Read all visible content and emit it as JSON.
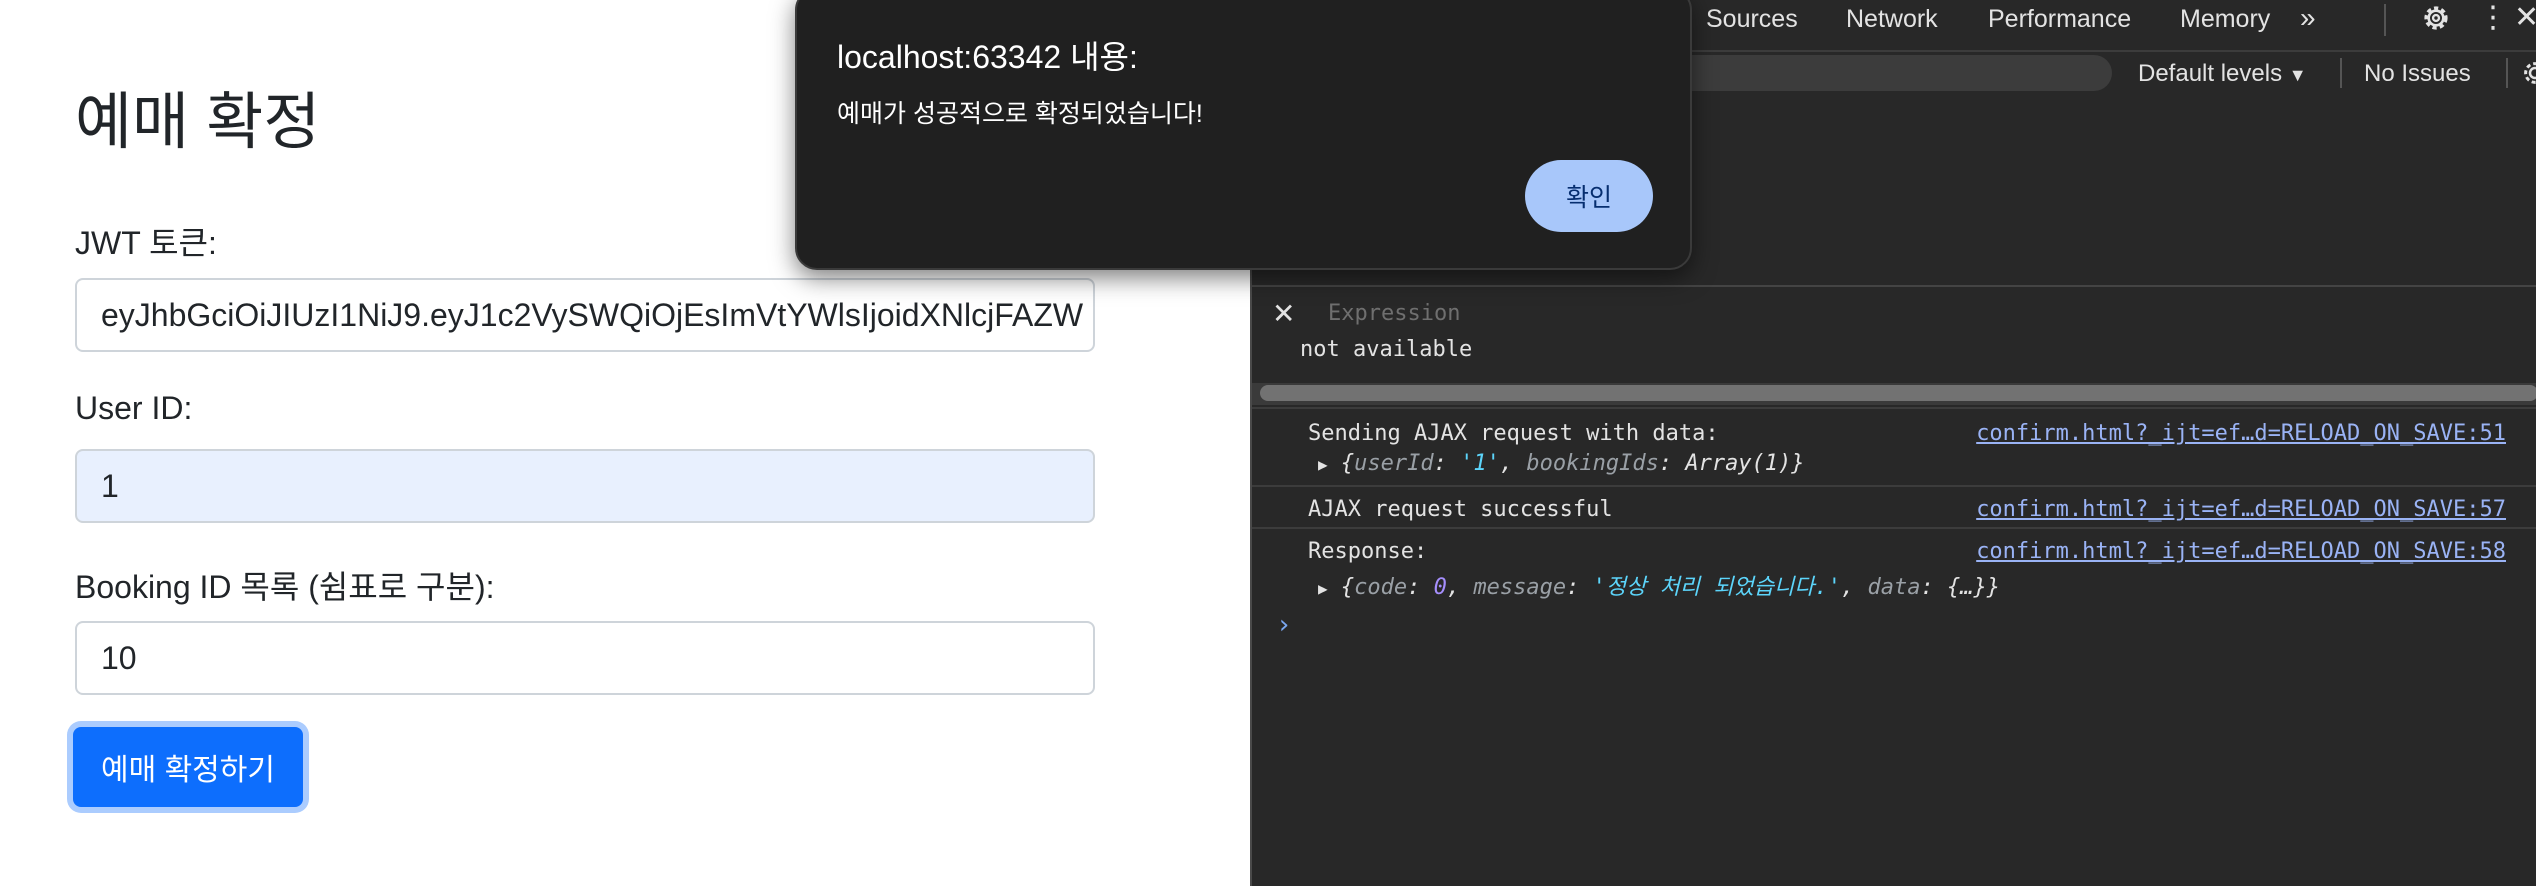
{
  "page": {
    "title": "예매 확정",
    "jwt_label": "JWT 토큰:",
    "jwt_value": "eyJhbGciOiJIUzI1NiJ9.eyJ1c2VySWQiOjEsImVtYWlsIjoidXNlcjFAZW",
    "userid_label": "User ID:",
    "userid_value": "1",
    "booking_label": "Booking ID 목록 (쉼표로 구분):",
    "booking_value": "10",
    "submit_label": "예매 확정하기",
    "colors": {
      "primary": "#0d6efd",
      "autofill": "#e8f0fe"
    }
  },
  "alert": {
    "title": "localhost:63342 내용:",
    "message": "예매가 성공적으로 확정되었습니다!",
    "ok_label": "확인",
    "colors": {
      "background": "#202020",
      "button": "#a8c7fa"
    }
  },
  "devtools": {
    "tabs": [
      "Sources",
      "Network",
      "Performance",
      "Memory"
    ],
    "more_icon": "chevron-double-right-icon",
    "settings_icon": "gear-icon",
    "menu_icon": "kebab-menu-icon",
    "close_icon": "close-icon",
    "default_levels": "Default levels",
    "no_issues": "No Issues",
    "expression": {
      "placeholder": "Expression",
      "value": "not available"
    },
    "console": [
      {
        "message": "Sending AJAX request with data:",
        "source": "confirm.html?_ijt=ef…d=RELOAD_ON_SAVE:51",
        "object": {
          "k1": "userId",
          "v1": "'1'",
          "k2": "bookingIds",
          "v2": "Array(1)"
        }
      },
      {
        "message": "AJAX request successful",
        "source": "confirm.html?_ijt=ef…d=RELOAD_ON_SAVE:57"
      },
      {
        "message": "Response:",
        "source": "confirm.html?_ijt=ef…d=RELOAD_ON_SAVE:58",
        "object": {
          "k1": "code",
          "v1": "0",
          "k2": "message",
          "v2": "'정상 처리 되었습니다.'",
          "k3": "data",
          "v3": "{…}"
        }
      }
    ],
    "prompt": "›"
  }
}
